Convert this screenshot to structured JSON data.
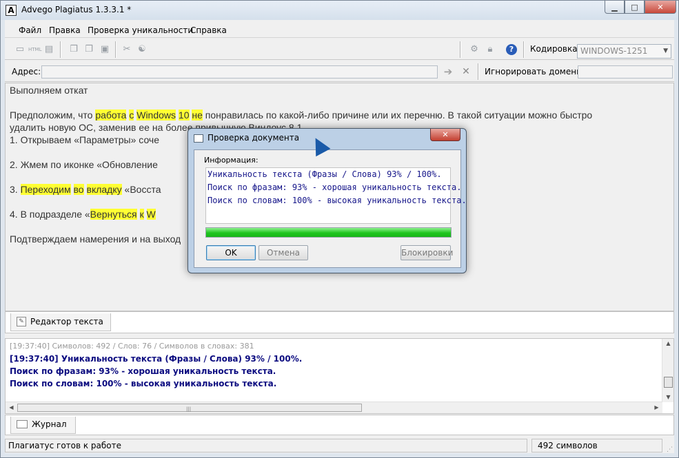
{
  "window": {
    "title": "Advego Plagiatus 1.3.3.1 *",
    "app_icon": "A"
  },
  "menu": {
    "items": [
      "Файл",
      "Правка",
      "Проверка уникальности",
      "Справка"
    ]
  },
  "toolbar": {
    "icons": [
      "new-doc-icon",
      "html-icon",
      "save-icon",
      "copy-icon",
      "cut-icon",
      "copy2-icon",
      "paste-icon",
      "settings-icon",
      "yin-yang-icon",
      "gear-icon",
      "lock-icon",
      "help-icon"
    ],
    "encoding_label": "Кодировка:",
    "encoding_value": "WINDOWS-1251"
  },
  "address": {
    "label": "Адрес:",
    "value": "",
    "ignore_label": "Игнорировать домены:",
    "ignore_value": ""
  },
  "editor": {
    "lines": [
      "Выполняем откат",
      "",
      "Предположим, что работа с Windows 10 не понравилась по какой-либо причине или их перечню. В такой ситуации можно быстро",
      "удалить новую ОС, заменив ее на более привычную Виндоус 8.1.",
      "1.      Открываем «Параметры» сочетанием клавиш Win+I или через меню «Пуск».",
      "2.      Жмем по иконке «Обновление и безопасность».",
      "3.      Переходим во вкладку «Восстановление».",
      "4.      В подразделе «Вернуться к Windows 8.1» кликаем по кнопке «Начать».",
      "Подтверждаем намерения и на выходе получаем ..."
    ],
    "para1_parts": [
      "Предположим, что ",
      "работа",
      " ",
      "с",
      " ",
      "Windows",
      " ",
      "10",
      " ",
      "не",
      " понравилась по какой-либо причине или их перечню. В такой ситуации можно быстро"
    ],
    "line2": "удалить новую ОС, заменив ее на более привычную Виндоус 8.1.",
    "item1": "1.      Открываем «Параметры» соче",
    "item2": "2.      Жмем по иконке «Обновление",
    "item3_parts": [
      "3.      ",
      "Переходим",
      " ",
      "во",
      " ",
      "вкладку",
      " «Восста"
    ],
    "item4_parts": [
      "4.      В подразделе «",
      "Вернуться",
      " ",
      "к",
      " ",
      "W"
    ],
    "last": "Подтверждаем намерения и на выход",
    "first": "Выполняем откат"
  },
  "tabs": {
    "editor": "Редактор текста",
    "journal": "Журнал"
  },
  "log": {
    "grey": "[19:37:40] Символов: 492 / Слов: 76 / Символов в словах: 381",
    "line1": "[19:37:40] Уникальность текста (Фразы / Слова) 93% / 100%.",
    "line2": "Поиск по фразам: 93% - хорошая уникальность текста.",
    "line3": "Поиск по словам: 100% - высокая уникальность текста."
  },
  "status": {
    "left": "Плагиатус готов к работе",
    "right": "492 символов"
  },
  "dialog": {
    "title": "Проверка документа",
    "info_label": "Информация:",
    "lines": [
      "Уникальность текста (Фразы / Слова) 93% / 100%.",
      "Поиск по фразам: 93% - хорошая уникальность текста.",
      "Поиск по словам: 100% - высокая уникальность текста."
    ],
    "progress": 1.0,
    "ok": "OK",
    "cancel": "Отмена",
    "block": "Блокировки"
  },
  "colors": {
    "highlight": "#ffff33",
    "log_blue": "#0b0b80",
    "progress": "#1fc51f"
  }
}
